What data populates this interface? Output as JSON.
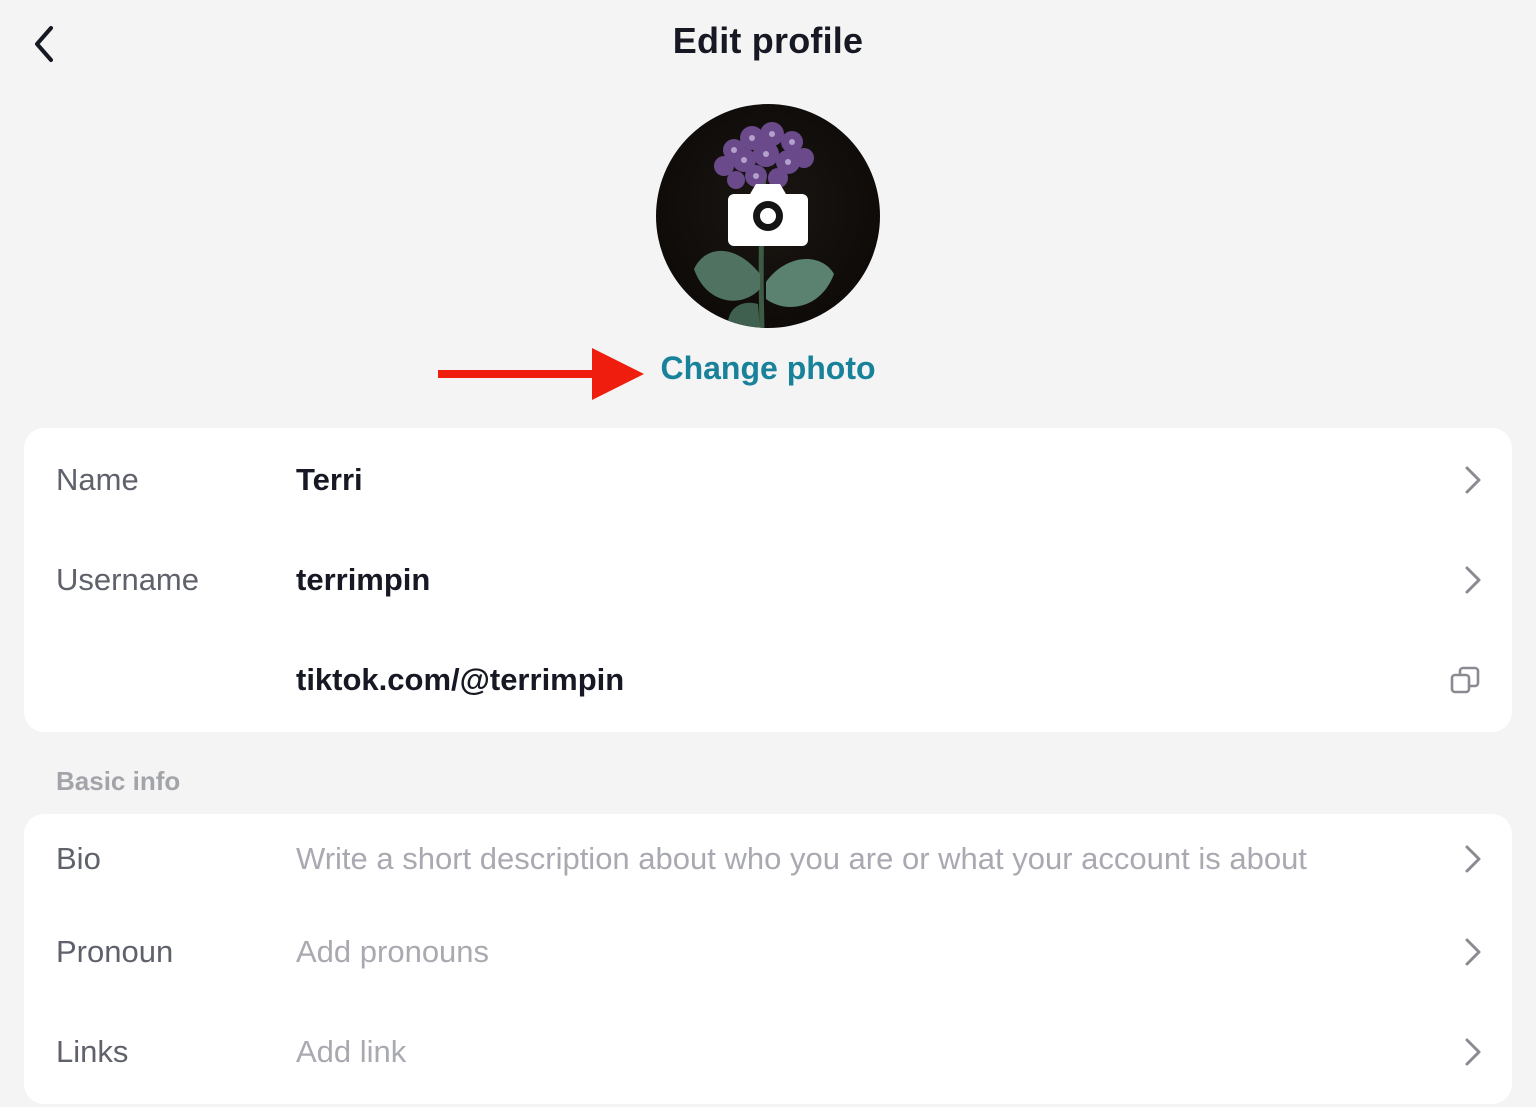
{
  "header": {
    "title": "Edit profile",
    "back_icon": "chevron-left-icon"
  },
  "avatar": {
    "camera_icon": "camera-icon",
    "change_photo_label": "Change photo",
    "annotation_arrow_color": "#ee1d0d"
  },
  "account": {
    "rows": [
      {
        "label": "Name",
        "value": "Terri",
        "icon": "chevron-right-icon"
      },
      {
        "label": "Username",
        "value": "terrimpin",
        "icon": "chevron-right-icon"
      },
      {
        "label": "",
        "value": "tiktok.com/@terrimpin",
        "icon": "copy-icon"
      }
    ]
  },
  "basic_info": {
    "section_title": "Basic info",
    "rows": [
      {
        "label": "Bio",
        "placeholder": "Write a short description about who you are or what your account is about",
        "icon": "chevron-right-icon"
      },
      {
        "label": "Pronoun",
        "placeholder": "Add pronouns",
        "icon": "chevron-right-icon"
      },
      {
        "label": "Links",
        "placeholder": "Add link",
        "icon": "chevron-right-icon"
      }
    ]
  },
  "colors": {
    "accent": "#18829a",
    "background": "#f4f4f4",
    "card": "#ffffff",
    "placeholder": "#a9aab1"
  }
}
